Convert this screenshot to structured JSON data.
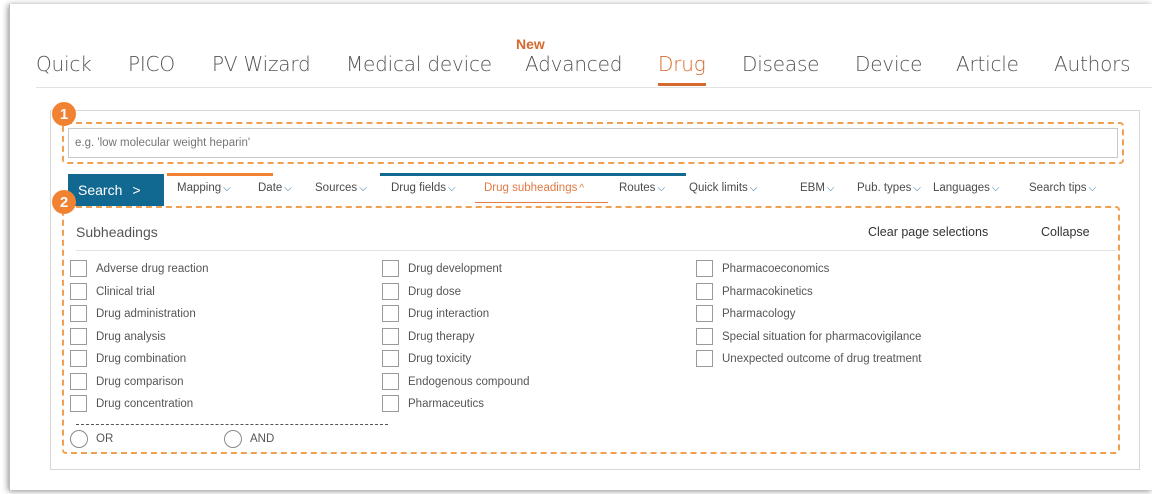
{
  "tabs": [
    {
      "label": "Quick"
    },
    {
      "label": "PICO"
    },
    {
      "label": "PV Wizard"
    },
    {
      "label": "Medical device"
    },
    {
      "label": "Advanced"
    },
    {
      "label": "Drug"
    },
    {
      "label": "Disease"
    },
    {
      "label": "Device"
    },
    {
      "label": "Article"
    },
    {
      "label": "Authors"
    }
  ],
  "active_tab": "Drug",
  "new_badge": "New",
  "callouts": {
    "one": "1",
    "two": "2"
  },
  "search": {
    "placeholder": "e.g. 'low molecular weight heparin'",
    "button_label": "Search",
    "button_chevron": ">"
  },
  "filters": [
    {
      "label": "Mapping"
    },
    {
      "label": "Date"
    },
    {
      "label": "Sources"
    },
    {
      "label": "Drug fields"
    },
    {
      "label": "Drug subheadings"
    },
    {
      "label": "Routes"
    },
    {
      "label": "Quick limits"
    },
    {
      "label": "EBM"
    },
    {
      "label": "Pub. types"
    },
    {
      "label": "Languages"
    },
    {
      "label": "Search tips"
    }
  ],
  "active_filter": "Drug subheadings",
  "subheadings": {
    "title": "Subheadings",
    "clear_label": "Clear page selections",
    "collapse_label": "Collapse",
    "col1": [
      "Adverse drug reaction",
      "Clinical trial",
      "Drug administration",
      "Drug analysis",
      "Drug combination",
      "Drug comparison",
      "Drug concentration"
    ],
    "col2": [
      "Drug development",
      "Drug dose",
      "Drug interaction",
      "Drug therapy",
      "Drug toxicity",
      "Endogenous compound",
      "Pharmaceutics"
    ],
    "col3": [
      "Pharmacoeconomics",
      "Pharmacokinetics",
      "Pharmacology",
      "Special situation for pharmacovigilance",
      "Unexpected outcome of drug treatment"
    ],
    "operators": [
      "OR",
      "AND"
    ]
  },
  "colors": {
    "accent": "#d66a2c",
    "callout": "#f08232",
    "button": "#116991"
  }
}
